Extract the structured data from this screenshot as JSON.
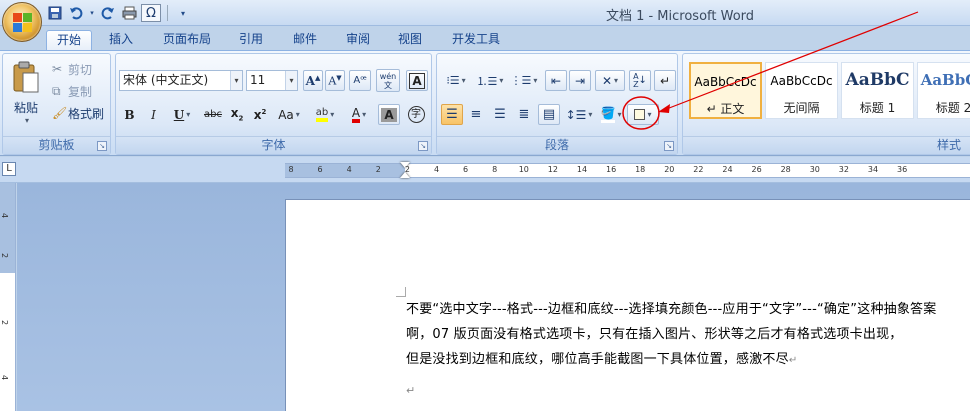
{
  "window": {
    "title": "文档 1 - Microsoft Word",
    "omega": "Ω"
  },
  "tabs": [
    "开始",
    "插入",
    "页面布局",
    "引用",
    "邮件",
    "审阅",
    "视图",
    "开发工具"
  ],
  "clipboard": {
    "paste_label": "粘贴",
    "cut_label": "剪切",
    "copy_label": "复制",
    "format_painter_label": "格式刷",
    "group_label": "剪贴板"
  },
  "font": {
    "font_name": "宋体 (中文正文)",
    "font_size": "11",
    "group_label": "字体",
    "wen_label": "wén\n文",
    "enclose_label": "字"
  },
  "paragraph": {
    "group_label": "段落"
  },
  "styles": {
    "items": [
      {
        "sample": "AaBbCcDc",
        "name": "↵ 正文"
      },
      {
        "sample": "AaBbCcDc",
        "name": "无间隔"
      },
      {
        "sample": "AaBbC",
        "name": "标题 1"
      },
      {
        "sample": "AaBbCc",
        "name": "标题 2"
      }
    ],
    "group_label": "样式"
  },
  "ruler": {
    "labels": [
      "8",
      "6",
      "4",
      "2",
      "2",
      "4",
      "6",
      "8",
      "10",
      "12",
      "14",
      "16",
      "18",
      "20",
      "22",
      "24",
      "26",
      "28",
      "30",
      "32",
      "34",
      "36"
    ],
    "vertical_labels": [
      "4",
      "2",
      "2",
      "4"
    ]
  },
  "document": {
    "line1": "不要“选中文字---格式---边框和底纹---选择填充颜色---应用于“文字”---“确定”这种抽象答案",
    "line2": "啊，07 版页面没有格式选项卡，只有在插入图片、形状等之后才有格式选项卡出现，",
    "line3": "但是没找到边框和底纹，哪位高手能截图一下具体位置，感激不尽",
    "para_mark": "↵"
  },
  "colors": {
    "ribbon_text": "#15428b",
    "annotation": "#e00000",
    "highlight_active": "#f8c366"
  }
}
